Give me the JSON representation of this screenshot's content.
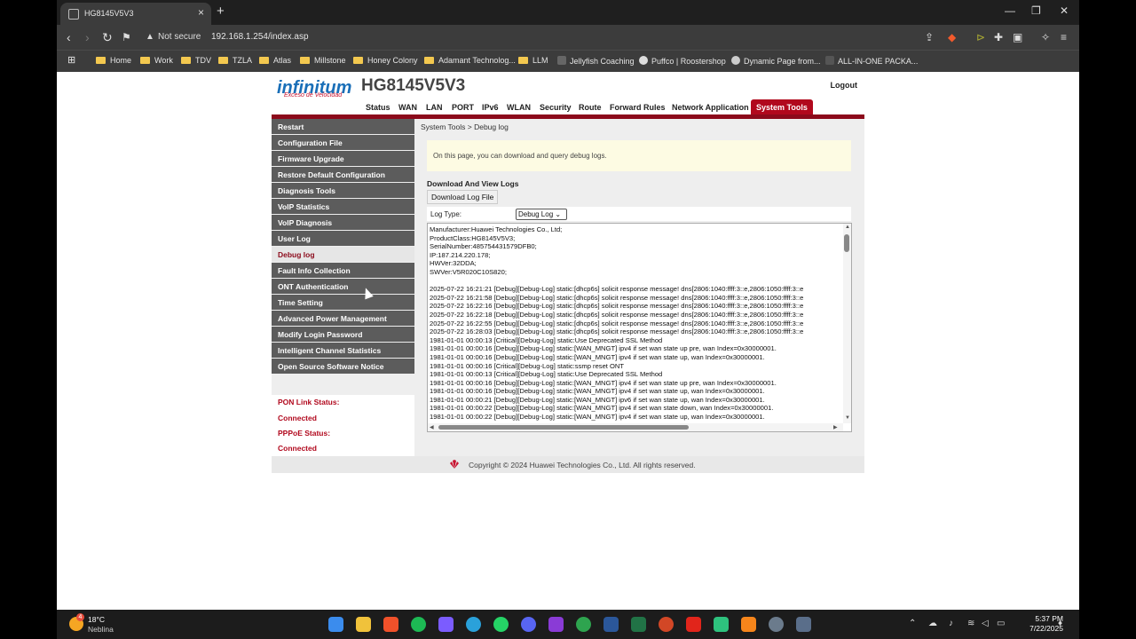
{
  "browser": {
    "tab_title": "HG8145V5V3",
    "security_label": "Not secure",
    "url": "192.168.1.254/index.asp",
    "bookmarks": [
      "Home",
      "Work",
      "TDV",
      "TZLA",
      "Atlas",
      "Millstone",
      "Honey Colony",
      "Adamant Technolog...",
      "LLM",
      "Jellyfish Coaching",
      "Puffco | Roostershop",
      "Dynamic Page from...",
      "ALL-IN-ONE PACKA..."
    ]
  },
  "router": {
    "brand": "infinitum",
    "brand_tagline": "Exceso de Velocidad",
    "model": "HG8145V5V3",
    "logout": "Logout",
    "topnav": [
      "Status",
      "WAN",
      "LAN",
      "PORT",
      "IPv6",
      "WLAN",
      "Security",
      "Route",
      "Forward Rules",
      "Network Application",
      "System Tools"
    ],
    "active_tab": "System Tools",
    "sidebar": [
      "Restart",
      "Configuration File",
      "Firmware Upgrade",
      "Restore Default Configuration",
      "Diagnosis Tools",
      "VoIP Statistics",
      "VoIP Diagnosis",
      "User Log",
      "Debug log",
      "Fault Info Collection",
      "ONT Authentication",
      "Time Setting",
      "Advanced Power Management",
      "Modify Login Password",
      "Intelligent Channel Statistics",
      "Open Source Software Notice"
    ],
    "active_sidebar": "Debug log",
    "pon_status_label": "PON Link Status:",
    "pon_status_value": "Connected",
    "pppoe_status_label": "PPPoE Status:",
    "pppoe_status_value": "Connected",
    "breadcrumb": "System Tools > Debug log",
    "info_text": "On this page, you can download and query debug logs.",
    "section_title": "Download And View Logs",
    "download_button": "Download Log File",
    "log_type_label": "Log Type:",
    "log_type_value": "Debug Log",
    "log_lines": [
      "Manufacturer:Huawei Technologies Co., Ltd;",
      "ProductClass:HG8145V5V3;",
      "SerialNumber:485754431579DFB0;",
      "IP:187.214.220.178;",
      "HWVer:32DDA;",
      "SWVer:V5R020C10S820;",
      "",
      "2025-07-22 16:21:21 [Debug][Debug-Log] static:[dhcp6s] solicit response message! dns[2806:1040:ffff:3::e,2806:1050:ffff:3::e",
      "2025-07-22 16:21:58 [Debug][Debug-Log] static:[dhcp6s] solicit response message! dns[2806:1040:ffff:3::e,2806:1050:ffff:3::e",
      "2025-07-22 16:22:16 [Debug][Debug-Log] static:[dhcp6s] solicit response message! dns[2806:1040:ffff:3::e,2806:1050:ffff:3::e",
      "2025-07-22 16:22:18 [Debug][Debug-Log] static:[dhcp6s] solicit response message! dns[2806:1040:ffff:3::e,2806:1050:ffff:3::e",
      "2025-07-22 16:22:55 [Debug][Debug-Log] static:[dhcp6s] solicit response message! dns[2806:1040:ffff:3::e,2806:1050:ffff:3::e",
      "2025-07-22 16:28:03 [Debug][Debug-Log] static:[dhcp6s] solicit response message! dns[2806:1040:ffff:3::e,2806:1050:ffff:3::e",
      "1981-01-01 00:00:13 [Critical][Debug-Log] static:Use Deprecated SSL Method",
      "1981-01-01 00:00:16 [Debug][Debug-Log] static:[WAN_MNGT] ipv4 if set wan state up pre, wan Index=0x30000001.",
      "1981-01-01 00:00:16 [Debug][Debug-Log] static:[WAN_MNGT] ipv4 if set wan state up, wan Index=0x30000001.",
      "1981-01-01 00:00:16 [Critical][Debug-Log] static:ssmp reset ONT",
      "1981-01-01 00:00:13 [Critical][Debug-Log] static:Use Deprecated SSL Method",
      "1981-01-01 00:00:16 [Debug][Debug-Log] static:[WAN_MNGT] ipv4 if set wan state up pre, wan Index=0x30000001.",
      "1981-01-01 00:00:16 [Debug][Debug-Log] static:[WAN_MNGT] ipv4 if set wan state up, wan Index=0x30000001.",
      "1981-01-01 00:00:21 [Debug][Debug-Log] static:[WAN_MNGT] ipv6 if set wan state up, wan Index=0x30000001.",
      "1981-01-01 00:00:22 [Debug][Debug-Log] static:[WAN_MNGT] ipv4 if set wan state down, wan Index=0x30000001.",
      "1981-01-01 00:00:22 [Debug][Debug-Log] static:[WAN_MNGT] ipv4 if set wan state up, wan Index=0x30000001."
    ],
    "copyright": "Copyright © 2024 Huawei Technologies Co., Ltd. All rights reserved."
  },
  "taskbar": {
    "weather_badge": "4",
    "temperature": "18°C",
    "condition": "Neblina",
    "time": "5:37 PM",
    "date": "7/22/2025"
  },
  "colors": {
    "brand_red": "#b1081d",
    "sidebar_gray": "#5c5c5c",
    "brand_blue": "#1a6fb8"
  }
}
